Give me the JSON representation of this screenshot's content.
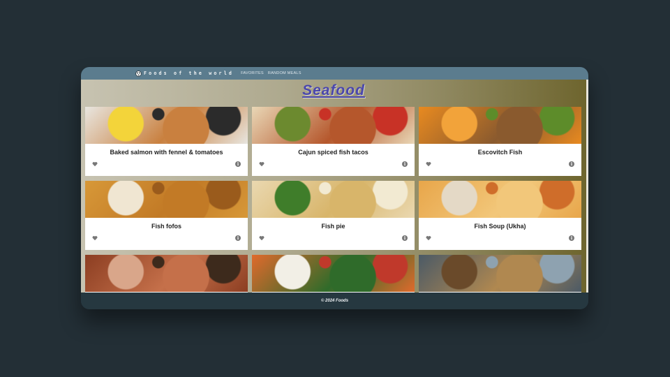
{
  "nav": {
    "brand": "Foods of the world",
    "links": [
      "FAVORITES",
      "RANDOM MEALS"
    ]
  },
  "page": {
    "title": "Seafood"
  },
  "meals": [
    {
      "name": "Baked salmon with fennel & tomatoes",
      "palette": [
        "#e8e6e0",
        "#c9803f",
        "#f3d43a",
        "#2b2b2b"
      ]
    },
    {
      "name": "Cajun spiced fish tacos",
      "palette": [
        "#e9d7b6",
        "#b5572c",
        "#6c8a2f",
        "#c83226"
      ]
    },
    {
      "name": "Escovitch Fish",
      "palette": [
        "#e88a20",
        "#8a5a2e",
        "#f2a33a",
        "#5d8c2a"
      ]
    },
    {
      "name": "Fish fofos",
      "palette": [
        "#d79838",
        "#c27a26",
        "#f0e6d2",
        "#9a5b1c"
      ]
    },
    {
      "name": "Fish pie",
      "palette": [
        "#ead8b0",
        "#d8b56a",
        "#3f7d2a",
        "#f2ead2"
      ]
    },
    {
      "name": "Fish Soup (Ukha)",
      "palette": [
        "#e8a64a",
        "#f2c77a",
        "#e4d9c6",
        "#cf6d2a"
      ]
    },
    {
      "name": "",
      "palette": [
        "#8c3e22",
        "#c5704a",
        "#d9a68a",
        "#3d2a1c"
      ]
    },
    {
      "name": "",
      "palette": [
        "#e06a2c",
        "#2f6b2a",
        "#f2efe6",
        "#c0392b"
      ]
    },
    {
      "name": "",
      "palette": [
        "#4b5a66",
        "#b08850",
        "#6a4a2a",
        "#8ea2b0"
      ]
    }
  ],
  "footer": {
    "text": "© 2024 Foods"
  },
  "colors": {
    "navbar": "#5b7c8e",
    "title": "#4a47ad",
    "footer": "#263840",
    "background": "#232f36"
  }
}
